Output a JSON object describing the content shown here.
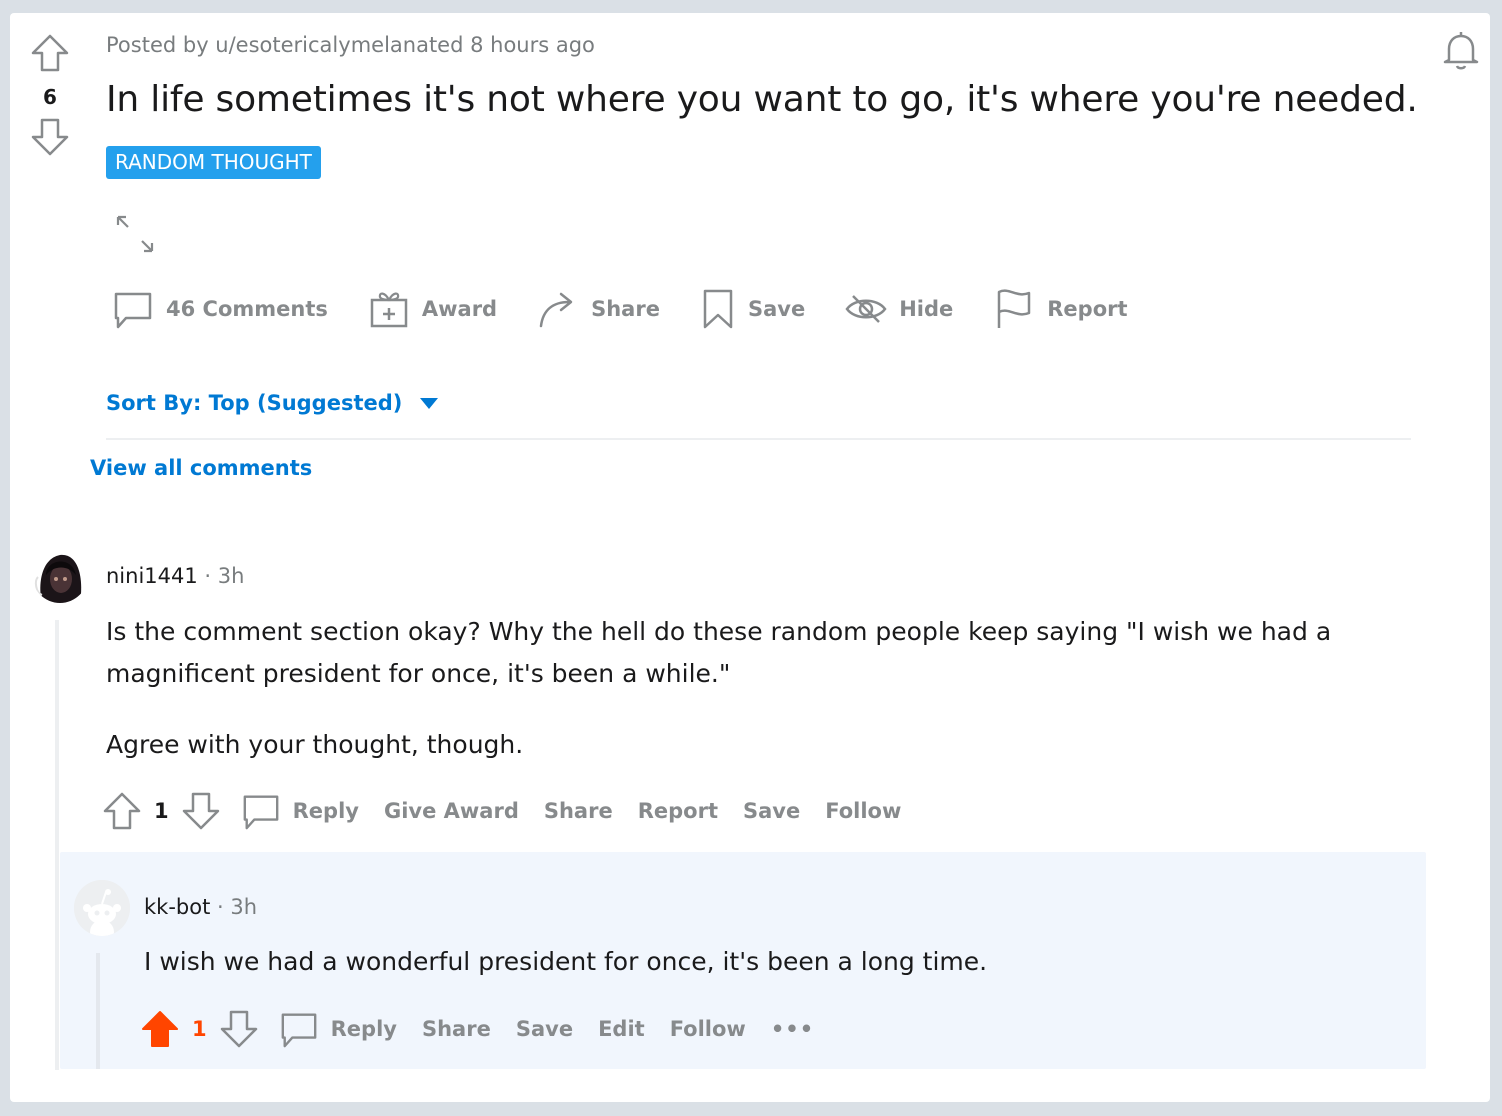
{
  "post": {
    "vote_count": "6",
    "meta": "Posted by u/esotericalymelanated 8 hours ago",
    "title": "In life sometimes it's not where you want to go, it's where you're needed.",
    "flair": "RANDOM THOUGHT",
    "actions": {
      "comments": "46 Comments",
      "award": "Award",
      "share": "Share",
      "save": "Save",
      "hide": "Hide",
      "report": "Report"
    }
  },
  "sort": {
    "label": "Sort By: Top (Suggested)"
  },
  "view_all": "View all comments",
  "comment": {
    "author": "nini1441",
    "time": "· 3h",
    "paragraphs": [
      "Is the comment section okay? Why the hell do these random people keep saying \"I wish we had a magnificent president for once, it's been a while.\"",
      "Agree with your thought, though."
    ],
    "vote_count": "1",
    "actions": {
      "reply": "Reply",
      "give_award": "Give Award",
      "share": "Share",
      "report": "Report",
      "save": "Save",
      "follow": "Follow"
    }
  },
  "reply": {
    "author": "kk-bot",
    "time": "· 3h",
    "body": "I wish we had a wonderful president for once, it's been a long time.",
    "vote_count": "1",
    "upvoted": true,
    "actions": {
      "reply": "Reply",
      "share": "Share",
      "save": "Save",
      "edit": "Edit",
      "follow": "Follow",
      "more": "•••"
    }
  },
  "colors": {
    "accent_blue": "#0079d3",
    "flair_bg": "#24a0ed",
    "upvote_orange": "#ff4500",
    "muted": "#878a8c"
  }
}
